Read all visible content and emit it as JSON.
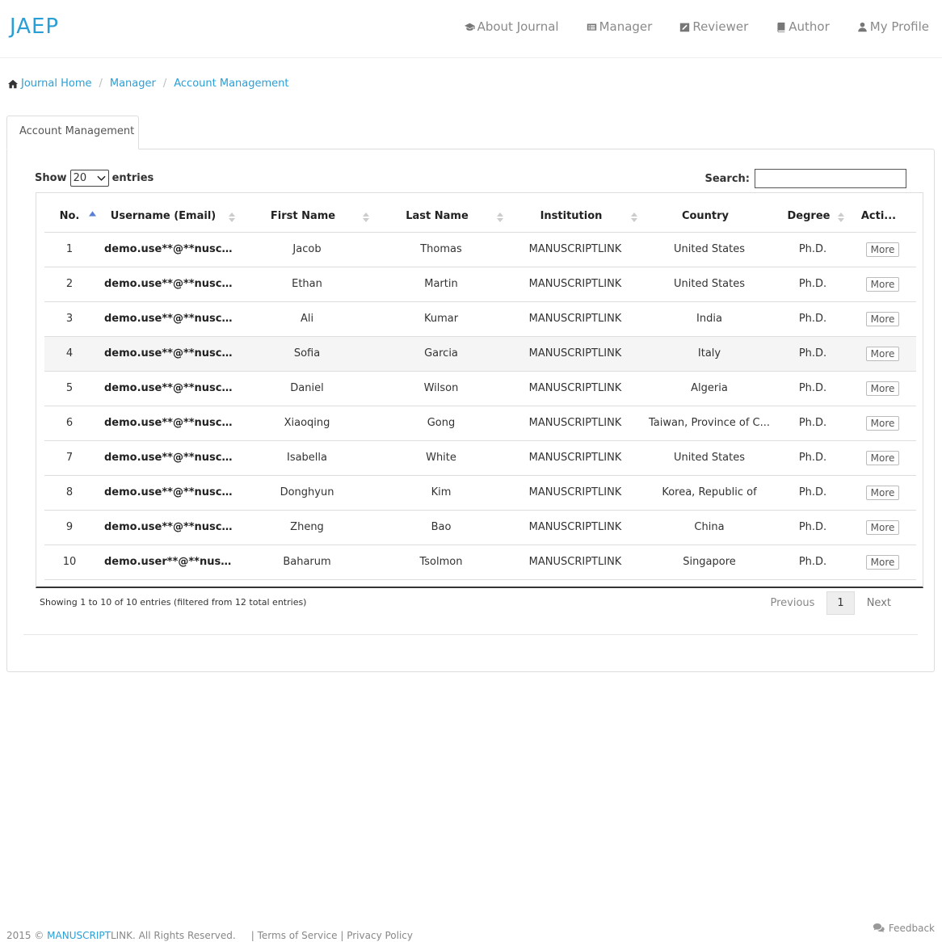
{
  "brand": "JAEP",
  "nav": [
    {
      "label": "About Journal",
      "icon": "graduation-cap-icon"
    },
    {
      "label": "Manager",
      "icon": "list-box-icon"
    },
    {
      "label": "Reviewer",
      "icon": "edit-icon"
    },
    {
      "label": "Author",
      "icon": "book-icon"
    },
    {
      "label": "My Profile",
      "icon": "user-icon"
    }
  ],
  "breadcrumb": [
    "Journal Home",
    "Manager",
    "Account Management"
  ],
  "tab_label": "Account Management",
  "controls": {
    "show_label": "Show",
    "entries_value": "20",
    "entries_label": "entries",
    "search_label": "Search:",
    "search_value": ""
  },
  "table": {
    "columns": [
      "No.",
      "Username (Email)",
      "First Name",
      "Last Name",
      "Institution",
      "Country",
      "Degree",
      "Acti..."
    ],
    "rows": [
      {
        "no": "1",
        "username": "demo.use**@**nuscrip...",
        "first": "Jacob",
        "last": "Thomas",
        "institution": "MANUSCRIPTLINK",
        "country": "United States",
        "degree": "Ph.D.",
        "action": "More"
      },
      {
        "no": "2",
        "username": "demo.use**@**nuscrip...",
        "first": "Ethan",
        "last": "Martin",
        "institution": "MANUSCRIPTLINK",
        "country": "United States",
        "degree": "Ph.D.",
        "action": "More"
      },
      {
        "no": "3",
        "username": "demo.use**@**nuscrip...",
        "first": "Ali",
        "last": "Kumar",
        "institution": "MANUSCRIPTLINK",
        "country": "India",
        "degree": "Ph.D.",
        "action": "More"
      },
      {
        "no": "4",
        "username": "demo.use**@**nuscrip...",
        "first": "Sofia",
        "last": "Garcia",
        "institution": "MANUSCRIPTLINK",
        "country": "Italy",
        "degree": "Ph.D.",
        "action": "More"
      },
      {
        "no": "5",
        "username": "demo.use**@**nuscrip...",
        "first": "Daniel",
        "last": "Wilson",
        "institution": "MANUSCRIPTLINK",
        "country": "Algeria",
        "degree": "Ph.D.",
        "action": "More"
      },
      {
        "no": "6",
        "username": "demo.use**@**nuscrip...",
        "first": "Xiaoqing",
        "last": "Gong",
        "institution": "MANUSCRIPTLINK",
        "country": "Taiwan, Province of C...",
        "degree": "Ph.D.",
        "action": "More"
      },
      {
        "no": "7",
        "username": "demo.use**@**nuscrip...",
        "first": "Isabella",
        "last": "White",
        "institution": "MANUSCRIPTLINK",
        "country": "United States",
        "degree": "Ph.D.",
        "action": "More"
      },
      {
        "no": "8",
        "username": "demo.use**@**nuscrip...",
        "first": "Donghyun",
        "last": "Kim",
        "institution": "MANUSCRIPTLINK",
        "country": "Korea, Republic of",
        "degree": "Ph.D.",
        "action": "More"
      },
      {
        "no": "9",
        "username": "demo.use**@**nuscrip...",
        "first": "Zheng",
        "last": "Bao",
        "institution": "MANUSCRIPTLINK",
        "country": "China",
        "degree": "Ph.D.",
        "action": "More"
      },
      {
        "no": "10",
        "username": "demo.user**@**nuscri...",
        "first": "Baharum",
        "last": "Tsolmon",
        "institution": "MANUSCRIPTLINK",
        "country": "Singapore",
        "degree": "Ph.D.",
        "action": "More"
      }
    ]
  },
  "info_text": "Showing 1 to 10 of 10 entries (filtered from 12 total entries)",
  "pagination": {
    "previous": "Previous",
    "current": "1",
    "next": "Next"
  },
  "footer": {
    "prefix": "2015 © ",
    "brand_a": "MANUSCRIPT",
    "brand_b": "LINK",
    "rights": ". All Rights Reserved.",
    "sep": "|",
    "terms": "Terms of Service",
    "privacy": "Privacy Policy",
    "feedback": "Feedback"
  },
  "colors": {
    "accent": "#2a9fd6",
    "stripe": "#f5f5f5",
    "border": "#dddddd"
  }
}
